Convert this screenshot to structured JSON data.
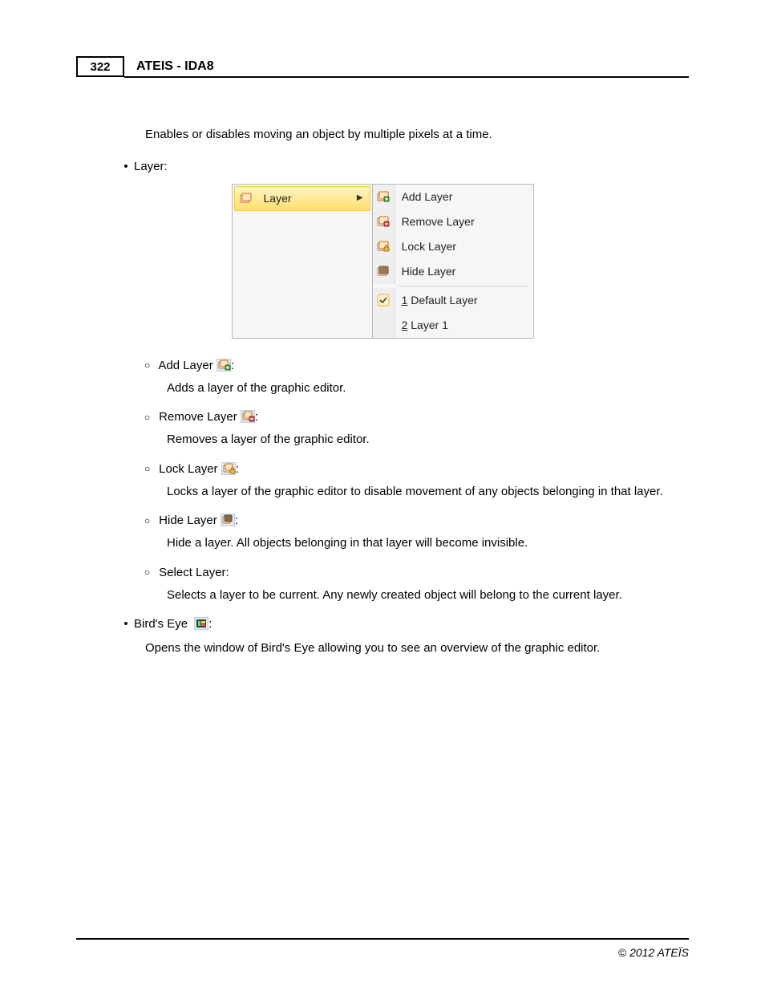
{
  "header": {
    "page_number": "322",
    "title": "ATEIS - IDA8"
  },
  "intro": "Enables or disables moving an object by multiple pixels at a time.",
  "bullets": {
    "layer_label": "Layer:",
    "birdseye_label": "Bird's Eye",
    "birdseye_colon": ":",
    "birdseye_desc": "Opens the window of Bird's Eye allowing you to see an overview of the graphic editor."
  },
  "menu": {
    "primary": "Layer",
    "items": {
      "add": "Add Layer",
      "remove": "Remove Layer",
      "lock": "Lock Layer",
      "hide": "Hide Layer",
      "default_num": "1",
      "default_rest": " Default Layer",
      "layer1_num": "2",
      "layer1_rest": " Layer 1"
    }
  },
  "sublist": {
    "add": {
      "label": "Add Layer ",
      "colon": ":",
      "desc": "Adds a layer of the graphic editor."
    },
    "remove": {
      "label": "Remove Layer ",
      "colon": ":",
      "desc": "Removes a layer of the graphic editor."
    },
    "lock": {
      "label": "Lock Layer ",
      "colon": ":",
      "desc": "Locks a layer of the graphic editor to disable movement of any objects belonging in that layer."
    },
    "hide": {
      "label": "Hide Layer ",
      "colon": ":",
      "desc": "Hide a layer. All objects belonging in that layer will become invisible."
    },
    "select": {
      "label": "Select Layer:",
      "desc": "Selects a layer to be current. Any newly created object will belong to the current layer."
    }
  },
  "footer": {
    "copyright": "© 2012 ATEÏS"
  }
}
